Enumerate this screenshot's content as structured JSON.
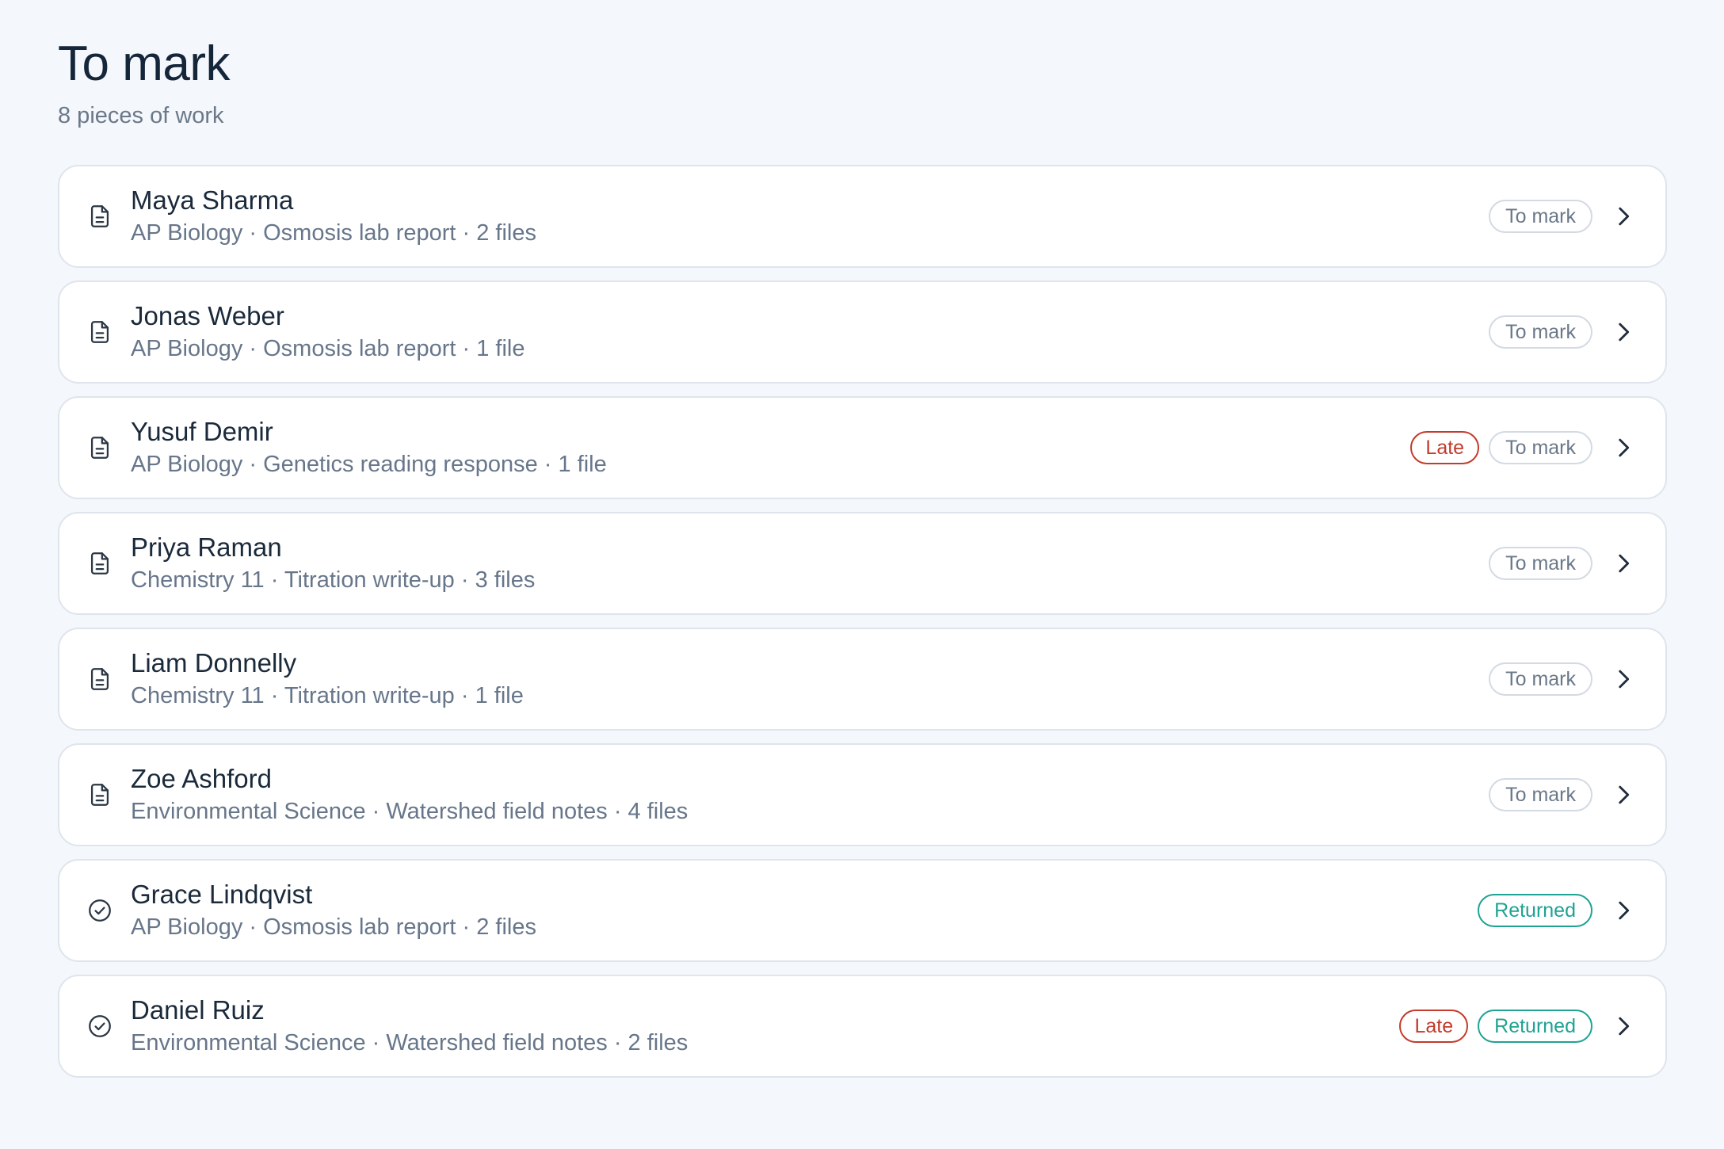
{
  "header": {
    "title": "To mark",
    "subtitle": "8 pieces of work"
  },
  "items": [
    {
      "name": "Maya Sharma",
      "meta": "AP Biology · Osmosis lab report · 2 files",
      "icon": "document-icon",
      "late": false,
      "late_label": "",
      "status": "To mark",
      "status_kind": "to-mark"
    },
    {
      "name": "Jonas Weber",
      "meta": "AP Biology · Osmosis lab report · 1 file",
      "icon": "document-icon",
      "late": false,
      "late_label": "",
      "status": "To mark",
      "status_kind": "to-mark"
    },
    {
      "name": "Yusuf Demir",
      "meta": "AP Biology · Genetics reading response · 1 file",
      "icon": "document-icon",
      "late": true,
      "late_label": "Late",
      "status": "To mark",
      "status_kind": "to-mark"
    },
    {
      "name": "Priya Raman",
      "meta": "Chemistry 11 · Titration write-up · 3 files",
      "icon": "document-icon",
      "late": false,
      "late_label": "",
      "status": "To mark",
      "status_kind": "to-mark"
    },
    {
      "name": "Liam Donnelly",
      "meta": "Chemistry 11 · Titration write-up · 1 file",
      "icon": "document-icon",
      "late": false,
      "late_label": "",
      "status": "To mark",
      "status_kind": "to-mark"
    },
    {
      "name": "Zoe Ashford",
      "meta": "Environmental Science · Watershed field notes · 4 files",
      "icon": "document-icon",
      "late": false,
      "late_label": "",
      "status": "To mark",
      "status_kind": "to-mark"
    },
    {
      "name": "Grace Lindqvist",
      "meta": "AP Biology · Osmosis lab report · 2 files",
      "icon": "check-circle-icon",
      "late": false,
      "late_label": "",
      "status": "Returned",
      "status_kind": "returned"
    },
    {
      "name": "Daniel Ruiz",
      "meta": "Environmental Science · Watershed field notes · 2 files",
      "icon": "check-circle-icon",
      "late": true,
      "late_label": "Late",
      "status": "Returned",
      "status_kind": "returned"
    }
  ],
  "colors": {
    "background": "#f4f7fb",
    "late": "#c23b2b",
    "returned": "#1fa393",
    "to_mark_border": "#d3dae3"
  }
}
